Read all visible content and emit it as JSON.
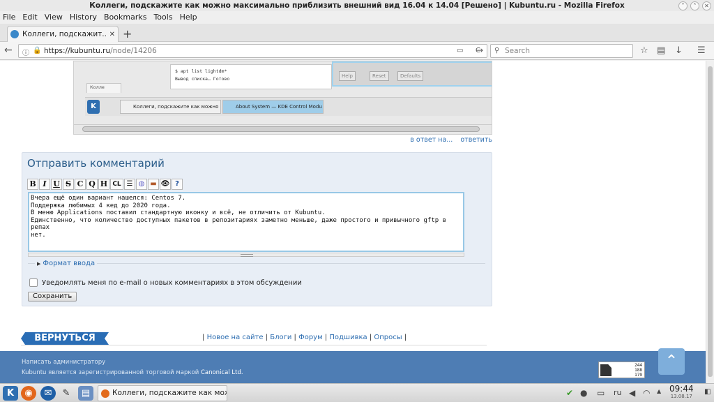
{
  "window": {
    "title": "Коллеги, подскажите как можно максимально приблизить внешний вид 16.04 к 14.04 [Решено] | Kubuntu.ru - Mozilla Firefox",
    "min_label": "˅",
    "max_label": "˄",
    "close_label": "✕"
  },
  "menu": [
    "File",
    "Edit",
    "View",
    "History",
    "Bookmarks",
    "Tools",
    "Help"
  ],
  "tab": {
    "title": "Коллеги, подскажит...",
    "close": "✕",
    "new_tab": "+"
  },
  "nav": {
    "back": "←",
    "url_host": "https://kubuntu.ru",
    "url_path": "/node/14206",
    "reader": "▭",
    "reload": "C",
    "go": "→",
    "search_placeholder": "Search",
    "icons": {
      "bookmark": "☆",
      "library": "▤",
      "download": "↓",
      "menu": "☰",
      "lock": "🔒",
      "info": "ⓘ",
      "search": "⚲"
    }
  },
  "embedded_screenshot": {
    "term_line1": "$ apt list lightdm*",
    "term_line2": "Вывод списка… Готово",
    "dialog_buttons": [
      "Help",
      "Reset",
      "Defaults"
    ],
    "inner_tab": "Колле",
    "task1": "Коллеги, подскажите как можно м",
    "task2": "About System — KDE Control Modu"
  },
  "reply_links": {
    "in_reply": "в ответ на...",
    "reply": "ответить"
  },
  "comment_form": {
    "title": "Отправить комментарий",
    "toolbar": [
      "B",
      "I",
      "U",
      "S",
      "C",
      "Q",
      "H",
      "CL",
      "☰",
      "◍",
      "▬",
      "👁",
      "?"
    ],
    "text": "Вчера ещё один вариант нашелся: Centos 7.\nПоддержка любимых 4 кед до 2020 года.\nВ меню Applications поставил стандартную иконку и всё, не отличить от Kubuntu.\nЕдинственно, что количество доступных пакетов в репозитариях заметно меньше, даже простого и привычного gftp в репах\nнет.",
    "format_label": "Формат ввода",
    "notify_label": "Уведомлять меня по e-mail о новых комментариях в этом обсуждении",
    "save_label": "Сохранить"
  },
  "footer": {
    "back_label": "ВЕРНУТЬСЯ",
    "links": [
      "Новое на сайте",
      "Блоги",
      "Форум",
      "Подшивка",
      "Опросы"
    ],
    "admin_line": "Написать администратору",
    "trademark_line_prefix": "Kubuntu является зарегистрированной торговой маркой ",
    "trademark_link": "Canonical Ltd.",
    "stats": [
      "244",
      "188",
      "179"
    ],
    "to_top": "⌃"
  },
  "taskbar": {
    "task_title": "Коллеги, подскажите как можно",
    "lang": "ru",
    "time": "09:44",
    "date": "13.08.17"
  },
  "colors": {
    "accent": "#2b6cb0",
    "footer_bg": "#4e7db4",
    "form_bg": "#e8eef6"
  }
}
